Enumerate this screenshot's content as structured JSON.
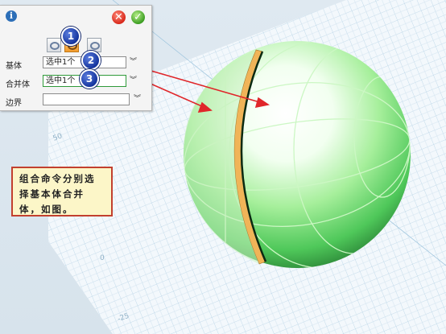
{
  "panel": {
    "info_icon": "info-icon",
    "cancel_icon": "cancel-icon",
    "confirm_icon": "confirm-icon",
    "modes": [
      "union-mode-icon",
      "subtract-mode-icon",
      "intersect-mode-icon"
    ],
    "rows": [
      {
        "label": "基体",
        "value": "选中1个"
      },
      {
        "label": "合并体",
        "value": "选中1个"
      },
      {
        "label": "边界",
        "value": ""
      }
    ]
  },
  "badges": [
    "1",
    "2",
    "3"
  ],
  "note": {
    "text": "组合命令分别选择基本体合并体，如图。"
  },
  "axis_ticks": [
    "50",
    "0",
    "-25"
  ],
  "colors": {
    "badge": "#1b3fae",
    "arrow": "#e0262a",
    "sphere": "#7fe27a",
    "grid": "#bcd8ea",
    "active_mode": "#f39b2a"
  }
}
